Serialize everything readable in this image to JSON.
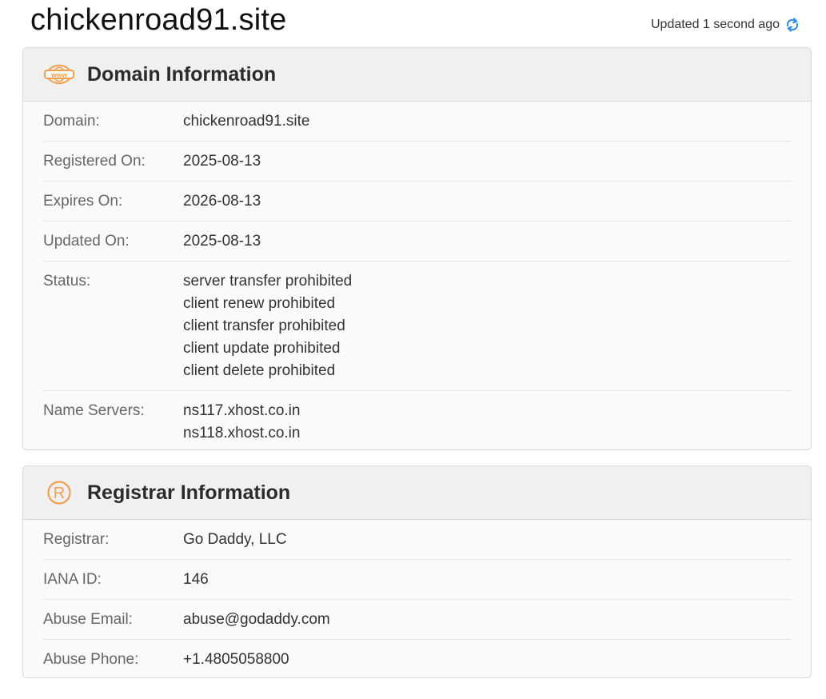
{
  "header": {
    "site_title": "chickenroad91.site",
    "updated_text": "Updated 1 second ago",
    "refresh_icon": "refresh-icon"
  },
  "colors": {
    "accent_orange": "#f0a050",
    "refresh_blue": "#3a8ee6"
  },
  "domain_info": {
    "title": "Domain Information",
    "icon": "www-icon",
    "rows": [
      {
        "label": "Domain:",
        "values": [
          "chickenroad91.site"
        ]
      },
      {
        "label": "Registered On:",
        "values": [
          "2025-08-13"
        ]
      },
      {
        "label": "Expires On:",
        "values": [
          "2026-08-13"
        ]
      },
      {
        "label": "Updated On:",
        "values": [
          "2025-08-13"
        ]
      },
      {
        "label": "Status:",
        "values": [
          "server transfer prohibited",
          "client renew prohibited",
          "client transfer prohibited",
          "client update prohibited",
          "client delete prohibited"
        ]
      },
      {
        "label": "Name Servers:",
        "values": [
          "ns117.xhost.co.in",
          "ns118.xhost.co.in"
        ]
      }
    ]
  },
  "registrar_info": {
    "title": "Registrar Information",
    "icon": "registered-icon",
    "rows": [
      {
        "label": "Registrar:",
        "values": [
          "Go Daddy, LLC"
        ]
      },
      {
        "label": "IANA ID:",
        "values": [
          "146"
        ]
      },
      {
        "label": "Abuse Email:",
        "values": [
          "abuse@godaddy.com"
        ]
      },
      {
        "label": "Abuse Phone:",
        "values": [
          "+1.4805058800"
        ]
      }
    ]
  }
}
